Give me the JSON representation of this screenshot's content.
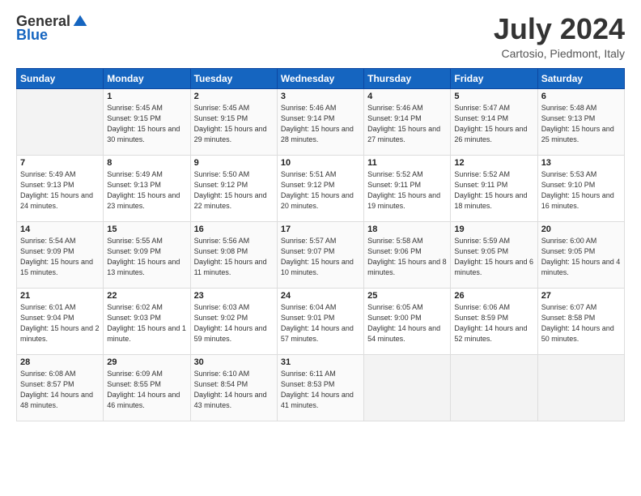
{
  "logo": {
    "general": "General",
    "blue": "Blue"
  },
  "title": {
    "month_year": "July 2024",
    "location": "Cartosio, Piedmont, Italy"
  },
  "days_of_week": [
    "Sunday",
    "Monday",
    "Tuesday",
    "Wednesday",
    "Thursday",
    "Friday",
    "Saturday"
  ],
  "weeks": [
    [
      {
        "day": "",
        "sunrise": "",
        "sunset": "",
        "daylight": ""
      },
      {
        "day": "1",
        "sunrise": "Sunrise: 5:45 AM",
        "sunset": "Sunset: 9:15 PM",
        "daylight": "Daylight: 15 hours and 30 minutes."
      },
      {
        "day": "2",
        "sunrise": "Sunrise: 5:45 AM",
        "sunset": "Sunset: 9:15 PM",
        "daylight": "Daylight: 15 hours and 29 minutes."
      },
      {
        "day": "3",
        "sunrise": "Sunrise: 5:46 AM",
        "sunset": "Sunset: 9:14 PM",
        "daylight": "Daylight: 15 hours and 28 minutes."
      },
      {
        "day": "4",
        "sunrise": "Sunrise: 5:46 AM",
        "sunset": "Sunset: 9:14 PM",
        "daylight": "Daylight: 15 hours and 27 minutes."
      },
      {
        "day": "5",
        "sunrise": "Sunrise: 5:47 AM",
        "sunset": "Sunset: 9:14 PM",
        "daylight": "Daylight: 15 hours and 26 minutes."
      },
      {
        "day": "6",
        "sunrise": "Sunrise: 5:48 AM",
        "sunset": "Sunset: 9:13 PM",
        "daylight": "Daylight: 15 hours and 25 minutes."
      }
    ],
    [
      {
        "day": "7",
        "sunrise": "Sunrise: 5:49 AM",
        "sunset": "Sunset: 9:13 PM",
        "daylight": "Daylight: 15 hours and 24 minutes."
      },
      {
        "day": "8",
        "sunrise": "Sunrise: 5:49 AM",
        "sunset": "Sunset: 9:13 PM",
        "daylight": "Daylight: 15 hours and 23 minutes."
      },
      {
        "day": "9",
        "sunrise": "Sunrise: 5:50 AM",
        "sunset": "Sunset: 9:12 PM",
        "daylight": "Daylight: 15 hours and 22 minutes."
      },
      {
        "day": "10",
        "sunrise": "Sunrise: 5:51 AM",
        "sunset": "Sunset: 9:12 PM",
        "daylight": "Daylight: 15 hours and 20 minutes."
      },
      {
        "day": "11",
        "sunrise": "Sunrise: 5:52 AM",
        "sunset": "Sunset: 9:11 PM",
        "daylight": "Daylight: 15 hours and 19 minutes."
      },
      {
        "day": "12",
        "sunrise": "Sunrise: 5:52 AM",
        "sunset": "Sunset: 9:11 PM",
        "daylight": "Daylight: 15 hours and 18 minutes."
      },
      {
        "day": "13",
        "sunrise": "Sunrise: 5:53 AM",
        "sunset": "Sunset: 9:10 PM",
        "daylight": "Daylight: 15 hours and 16 minutes."
      }
    ],
    [
      {
        "day": "14",
        "sunrise": "Sunrise: 5:54 AM",
        "sunset": "Sunset: 9:09 PM",
        "daylight": "Daylight: 15 hours and 15 minutes."
      },
      {
        "day": "15",
        "sunrise": "Sunrise: 5:55 AM",
        "sunset": "Sunset: 9:09 PM",
        "daylight": "Daylight: 15 hours and 13 minutes."
      },
      {
        "day": "16",
        "sunrise": "Sunrise: 5:56 AM",
        "sunset": "Sunset: 9:08 PM",
        "daylight": "Daylight: 15 hours and 11 minutes."
      },
      {
        "day": "17",
        "sunrise": "Sunrise: 5:57 AM",
        "sunset": "Sunset: 9:07 PM",
        "daylight": "Daylight: 15 hours and 10 minutes."
      },
      {
        "day": "18",
        "sunrise": "Sunrise: 5:58 AM",
        "sunset": "Sunset: 9:06 PM",
        "daylight": "Daylight: 15 hours and 8 minutes."
      },
      {
        "day": "19",
        "sunrise": "Sunrise: 5:59 AM",
        "sunset": "Sunset: 9:05 PM",
        "daylight": "Daylight: 15 hours and 6 minutes."
      },
      {
        "day": "20",
        "sunrise": "Sunrise: 6:00 AM",
        "sunset": "Sunset: 9:05 PM",
        "daylight": "Daylight: 15 hours and 4 minutes."
      }
    ],
    [
      {
        "day": "21",
        "sunrise": "Sunrise: 6:01 AM",
        "sunset": "Sunset: 9:04 PM",
        "daylight": "Daylight: 15 hours and 2 minutes."
      },
      {
        "day": "22",
        "sunrise": "Sunrise: 6:02 AM",
        "sunset": "Sunset: 9:03 PM",
        "daylight": "Daylight: 15 hours and 1 minute."
      },
      {
        "day": "23",
        "sunrise": "Sunrise: 6:03 AM",
        "sunset": "Sunset: 9:02 PM",
        "daylight": "Daylight: 14 hours and 59 minutes."
      },
      {
        "day": "24",
        "sunrise": "Sunrise: 6:04 AM",
        "sunset": "Sunset: 9:01 PM",
        "daylight": "Daylight: 14 hours and 57 minutes."
      },
      {
        "day": "25",
        "sunrise": "Sunrise: 6:05 AM",
        "sunset": "Sunset: 9:00 PM",
        "daylight": "Daylight: 14 hours and 54 minutes."
      },
      {
        "day": "26",
        "sunrise": "Sunrise: 6:06 AM",
        "sunset": "Sunset: 8:59 PM",
        "daylight": "Daylight: 14 hours and 52 minutes."
      },
      {
        "day": "27",
        "sunrise": "Sunrise: 6:07 AM",
        "sunset": "Sunset: 8:58 PM",
        "daylight": "Daylight: 14 hours and 50 minutes."
      }
    ],
    [
      {
        "day": "28",
        "sunrise": "Sunrise: 6:08 AM",
        "sunset": "Sunset: 8:57 PM",
        "daylight": "Daylight: 14 hours and 48 minutes."
      },
      {
        "day": "29",
        "sunrise": "Sunrise: 6:09 AM",
        "sunset": "Sunset: 8:55 PM",
        "daylight": "Daylight: 14 hours and 46 minutes."
      },
      {
        "day": "30",
        "sunrise": "Sunrise: 6:10 AM",
        "sunset": "Sunset: 8:54 PM",
        "daylight": "Daylight: 14 hours and 43 minutes."
      },
      {
        "day": "31",
        "sunrise": "Sunrise: 6:11 AM",
        "sunset": "Sunset: 8:53 PM",
        "daylight": "Daylight: 14 hours and 41 minutes."
      },
      {
        "day": "",
        "sunrise": "",
        "sunset": "",
        "daylight": ""
      },
      {
        "day": "",
        "sunrise": "",
        "sunset": "",
        "daylight": ""
      },
      {
        "day": "",
        "sunrise": "",
        "sunset": "",
        "daylight": ""
      }
    ]
  ]
}
